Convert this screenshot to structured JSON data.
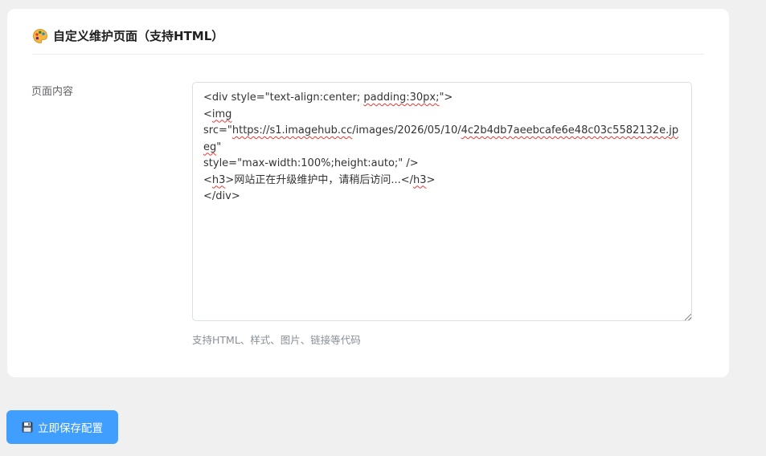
{
  "card": {
    "title": "自定义维护页面（支持HTML）",
    "icon": "palette-icon"
  },
  "form": {
    "label": "页面内容",
    "content_lines": [
      {
        "parts": [
          {
            "t": "<div style=\"text-align:center; ",
            "s": false
          },
          {
            "t": "padding:30px;",
            "s": true
          },
          {
            "t": "\">",
            "s": false
          }
        ]
      },
      {
        "parts": [
          {
            "t": "<",
            "s": false
          },
          {
            "t": "img",
            "s": true
          }
        ]
      },
      {
        "parts": [
          {
            "t": "src=\"",
            "s": false
          },
          {
            "t": "https://s1.imagehub.cc",
            "s": true
          },
          {
            "t": "/images/2026/05/10/",
            "s": false
          },
          {
            "t": "4c2b4db7aeebcafe6e48c03c5582132e.jpeg",
            "s": true
          },
          {
            "t": "\"",
            "s": false
          }
        ]
      },
      {
        "parts": [
          {
            "t": "style=\"max-width:100%;height:auto;\" />",
            "s": false
          }
        ]
      },
      {
        "parts": [
          {
            "t": "<",
            "s": false
          },
          {
            "t": "h3",
            "s": true
          },
          {
            "t": ">网站正在升级维护中，请稍后访问...</",
            "s": false
          },
          {
            "t": "h3",
            "s": true
          },
          {
            "t": ">",
            "s": false
          }
        ]
      },
      {
        "parts": [
          {
            "t": "</div>",
            "s": false
          }
        ]
      }
    ],
    "hint": "支持HTML、样式、图片、链接等代码"
  },
  "actions": {
    "save_label": "立即保存配置",
    "save_icon": "floppy-disk-icon"
  },
  "colors": {
    "primary": "#409eff",
    "background": "#f0f0f0",
    "card": "#ffffff",
    "spellcheck": "#e53935"
  }
}
